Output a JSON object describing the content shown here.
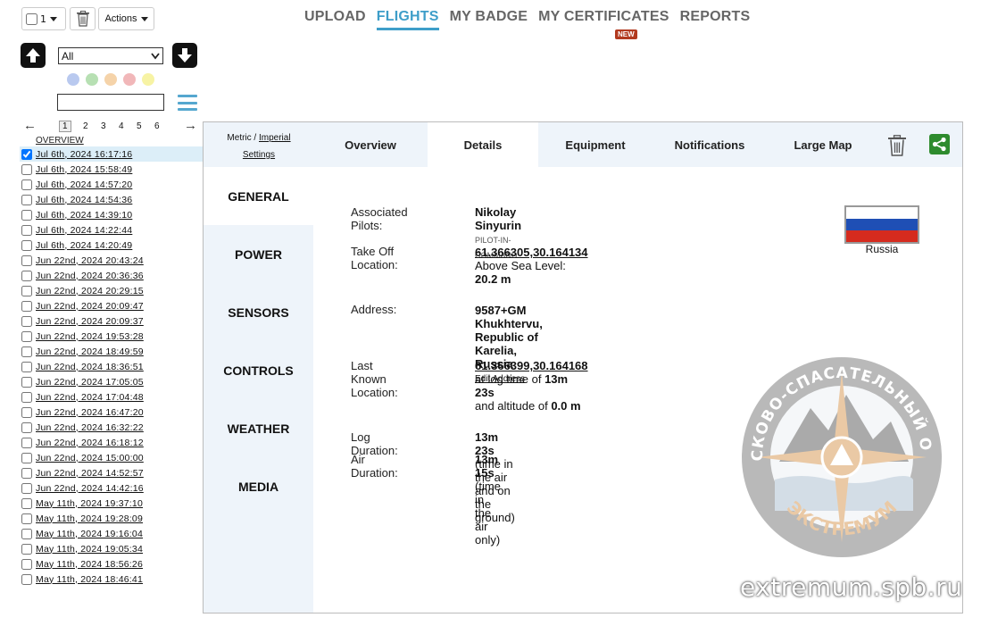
{
  "toolbar": {
    "select_count": "1",
    "actions_label": "Actions"
  },
  "filter": {
    "selected": "All",
    "search_value": ""
  },
  "color_filters": [
    "#b9c9ef",
    "#b7e0b3",
    "#f5d3a9",
    "#f1b7b9",
    "#f7f3a4"
  ],
  "pager": {
    "pages": [
      "1",
      "2",
      "3",
      "4",
      "5",
      "6"
    ],
    "current": "1"
  },
  "overview_label": "OVERVIEW",
  "flights": [
    "Jul 6th, 2024 16:17:16",
    "Jul 6th, 2024 15:58:49",
    "Jul 6th, 2024 14:57:20",
    "Jul 6th, 2024 14:54:36",
    "Jul 6th, 2024 14:39:10",
    "Jul 6th, 2024 14:22:44",
    "Jul 6th, 2024 14:20:49",
    "Jun 22nd, 2024 20:43:24",
    "Jun 22nd, 2024 20:36:36",
    "Jun 22nd, 2024 20:29:15",
    "Jun 22nd, 2024 20:09:47",
    "Jun 22nd, 2024 20:09:37",
    "Jun 22nd, 2024 19:53:28",
    "Jun 22nd, 2024 18:49:59",
    "Jun 22nd, 2024 18:36:51",
    "Jun 22nd, 2024 17:05:05",
    "Jun 22nd, 2024 17:04:48",
    "Jun 22nd, 2024 16:47:20",
    "Jun 22nd, 2024 16:32:22",
    "Jun 22nd, 2024 16:18:12",
    "Jun 22nd, 2024 15:00:00",
    "Jun 22nd, 2024 14:52:57",
    "Jun 22nd, 2024 14:42:16",
    "May 11th, 2024 19:37:10",
    "May 11th, 2024 19:28:09",
    "May 11th, 2024 19:16:04",
    "May 11th, 2024 19:05:34",
    "May 11th, 2024 18:56:26",
    "May 11th, 2024 18:46:41"
  ],
  "checked_flight_index": 0,
  "topnav": {
    "upload": "UPLOAD",
    "flights": "FLIGHTS",
    "my_badge": "MY BADGE",
    "my_certificates": "MY CERTIFICATES",
    "reports": "REPORTS",
    "new_badge": "NEW"
  },
  "panel": {
    "units_metric": "Metric",
    "units_sep": " / ",
    "units_imperial": "Imperial",
    "settings": "Settings",
    "tabs": {
      "overview": "Overview",
      "details": "Details",
      "equipment": "Equipment",
      "notifications": "Notifications",
      "large_map": "Large Map"
    },
    "side": {
      "general": "GENERAL",
      "power": "POWER",
      "sensors": "SENSORS",
      "controls": "CONTROLS",
      "weather": "WEATHER",
      "media": "MEDIA"
    }
  },
  "details": {
    "pilots_label": "Associated Pilots:",
    "pilot_name": "Nikolay Sinyurin",
    "pilot_role": "PILOT-IN-COMMAND",
    "takeoff_label": "Take Off Location:",
    "takeoff_coords": "61.366305,30.164134",
    "asl_label": "Above Sea Level:",
    "asl_value": "20.2 m",
    "address_label": "Address:",
    "address_value": "9587+GM Khukhtervu, Republic of Karelia, Russia",
    "edit_address": "Edit Address",
    "last_label": "Last Known Location:",
    "last_coords": "61.366399,30.164168",
    "logtime_prefix": "at log time of",
    "logtime_value": "13m 23s",
    "alt_prefix": "and altitude of",
    "alt_value": "0.0 m",
    "log_duration_label": "Log Duration:",
    "log_duration_value": "13m 23s",
    "log_duration_note": "(time in the air and on the ground)",
    "air_duration_label": "Air Duration:",
    "air_duration_value": "13m 15s",
    "air_duration_note": "(time in the air only)",
    "country": "Russia",
    "flag_colors": [
      "#ffffff",
      "#1f4fb5",
      "#d52b1e"
    ]
  },
  "emblem": {
    "top_text": "ПОИСКОВО-СПАСАТЕЛЬНЫЙ ОТРЯД",
    "bottom_text": "ЭКСТРЕМУМ"
  },
  "watermark": "extremum.spb.ru"
}
